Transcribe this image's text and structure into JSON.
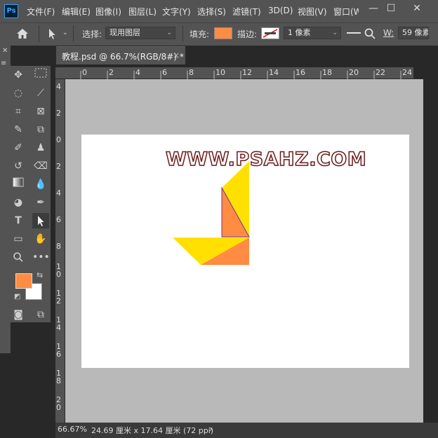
{
  "app": {
    "logo_text": "Ps"
  },
  "menu": [
    "文件(F)",
    "编辑(E)",
    "图像(I)",
    "图层(L)",
    "文字(Y)",
    "选择(S)",
    "滤镜(T)",
    "3D(D)",
    "视图(V)",
    "窗口(W"
  ],
  "window_controls": {
    "minimize": "—",
    "restore": "☐",
    "close": "✕"
  },
  "options": {
    "select_label": "选择:",
    "select_value": "现用图层",
    "fill_label": "填充:",
    "fill_color": "#ff8c42",
    "stroke_label": "描边:",
    "stroke_width": "1 像素",
    "w_label": "W:",
    "w_value": "59 像素"
  },
  "document": {
    "tab_title": "教程.psd @ 66.7%(RGB/8#) *",
    "close": "×"
  },
  "rulers": {
    "top": [
      "0",
      "2",
      "4",
      "6",
      "8",
      "10",
      "12",
      "14",
      "16",
      "18",
      "20",
      "22",
      "24"
    ],
    "left": [
      "4",
      "2",
      "0",
      "2",
      "4",
      "6",
      "8",
      "1\n0",
      "1\n2",
      "1\n4",
      "1\n6",
      "1\n8",
      "2\n0"
    ]
  },
  "canvas": {
    "watermark": "WWW.PSAHZ.COM",
    "colors": {
      "yellow": "#ffe000",
      "orange": "#ff8c42",
      "outline": "#7030a0"
    }
  },
  "colors": {
    "foreground": "#ff8c42",
    "background": "#ffffff"
  },
  "status": {
    "zoom": "66.67%",
    "doc_size": "24.69 厘米 x 17.64 厘米 (72 ppi)",
    "arrow": "›"
  }
}
